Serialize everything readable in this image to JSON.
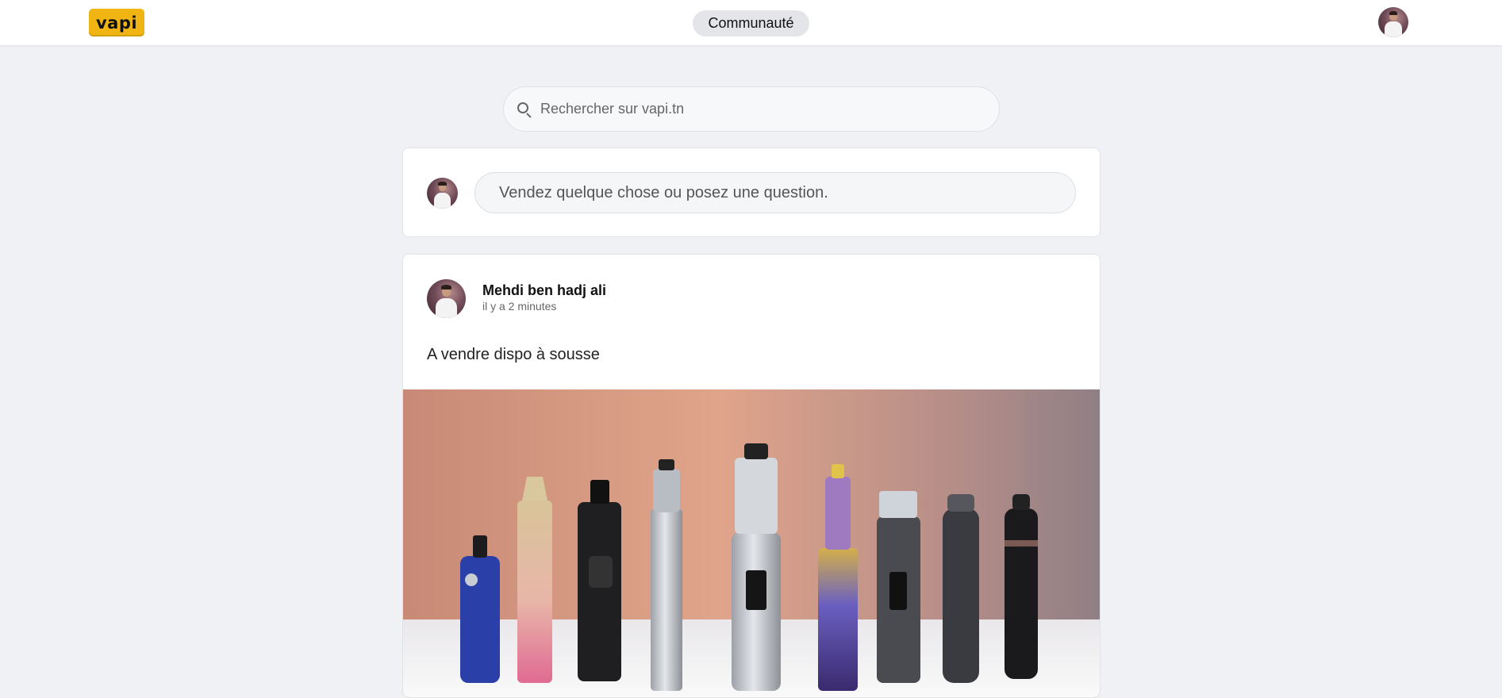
{
  "header": {
    "logo_text": "vapi",
    "nav_label": "Communauté",
    "brand_color": "#f0b512"
  },
  "search": {
    "placeholder": "Rechercher sur vapi.tn",
    "icon": "search-icon"
  },
  "composer": {
    "placeholder": "Vendez quelque chose ou posez une question."
  },
  "post": {
    "author": "Mehdi ben hadj ali",
    "time": "il y a 2 minutes",
    "text": "A vendre dispo à sousse",
    "image": "vape-devices-photo"
  }
}
